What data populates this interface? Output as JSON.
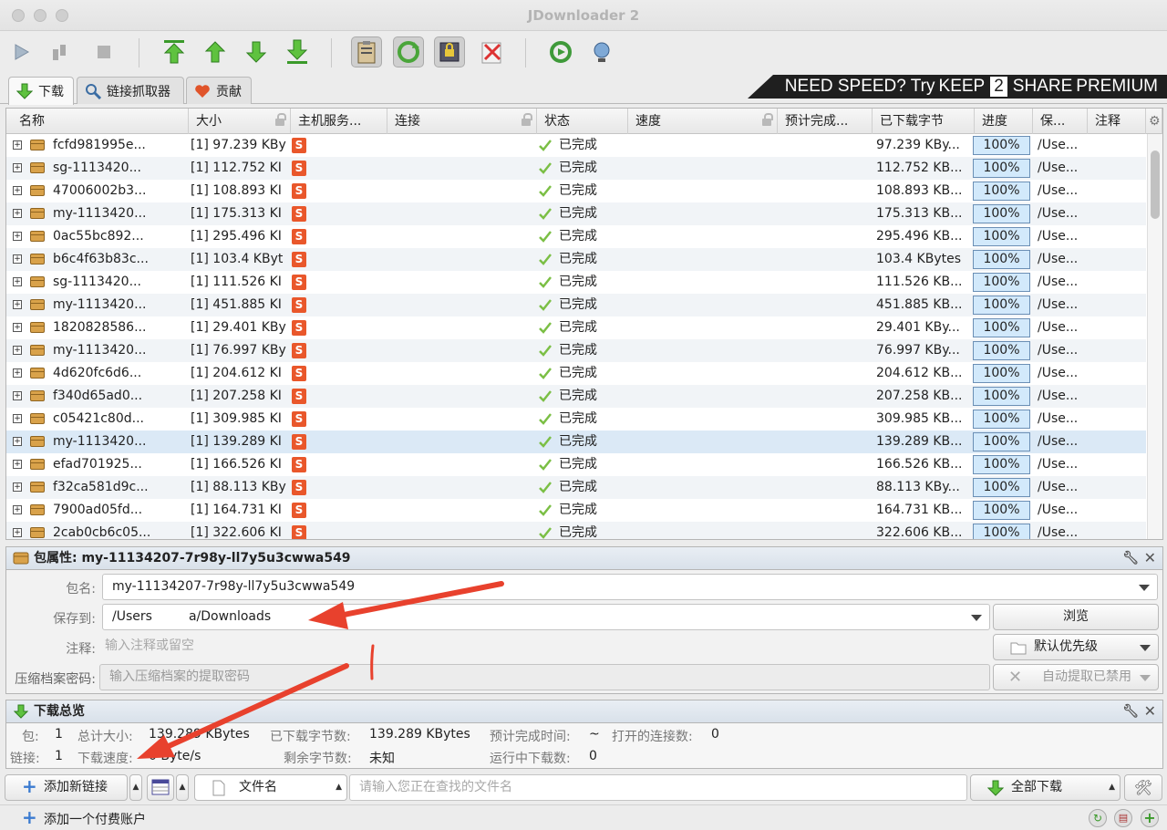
{
  "window": {
    "title": "JDownloader 2"
  },
  "toolbar": {
    "buttons": [
      "play-icon",
      "pause-icon",
      "stop-icon",
      "move-top-icon",
      "move-up-icon",
      "move-down-icon",
      "move-bottom-icon",
      "clipboard-observer-icon",
      "auto-reconnect-icon",
      "premium-lock-icon",
      "silent-mode-icon",
      "update-icon",
      "reconnect-icon"
    ]
  },
  "tabs": [
    {
      "label": "下载",
      "icon": "download-arrow-icon",
      "active": true
    },
    {
      "label": "链接抓取器",
      "icon": "linkgrabber-icon",
      "active": false
    },
    {
      "label": "贡献",
      "icon": "heart-icon",
      "active": false
    }
  ],
  "banner": {
    "text1": "NEED SPEED? Try ",
    "text2": "KEEP",
    "num": "2",
    "text3": "SHARE",
    "text4": " PREMIUM"
  },
  "table": {
    "headers": {
      "name": "名称",
      "size": "大小",
      "host": "主机服务...",
      "connection": "连接",
      "status": "状态",
      "speed": "速度",
      "eta": "预计完成...",
      "downloaded": "已下载字节",
      "progress": "进度",
      "save": "保...",
      "comment": "注释"
    },
    "rows": [
      {
        "name": "fcfd981995e...",
        "size": "[1]  97.239 KBy",
        "status": "已完成",
        "downloaded": "97.239 KBy...",
        "progress": "100%",
        "save": "/Use..."
      },
      {
        "name": "sg-1113420...",
        "size": "[1]  112.752 KI",
        "status": "已完成",
        "downloaded": "112.752 KB...",
        "progress": "100%",
        "save": "/Use..."
      },
      {
        "name": "47006002b3...",
        "size": "[1]  108.893 KI",
        "status": "已完成",
        "downloaded": "108.893 KB...",
        "progress": "100%",
        "save": "/Use..."
      },
      {
        "name": "my-1113420...",
        "size": "[1]  175.313 KI",
        "status": "已完成",
        "downloaded": "175.313 KB...",
        "progress": "100%",
        "save": "/Use..."
      },
      {
        "name": "0ac55bc892...",
        "size": "[1]  295.496 KI",
        "status": "已完成",
        "downloaded": "295.496 KB...",
        "progress": "100%",
        "save": "/Use..."
      },
      {
        "name": "b6c4f63b83c...",
        "size": "[1]  103.4 KByt",
        "status": "已完成",
        "downloaded": "103.4 KBytes",
        "progress": "100%",
        "save": "/Use..."
      },
      {
        "name": "sg-1113420...",
        "size": "[1]  111.526 KI",
        "status": "已完成",
        "downloaded": "111.526 KB...",
        "progress": "100%",
        "save": "/Use..."
      },
      {
        "name": "my-1113420...",
        "size": "[1]  451.885 KI",
        "status": "已完成",
        "downloaded": "451.885 KB...",
        "progress": "100%",
        "save": "/Use..."
      },
      {
        "name": "1820828586...",
        "size": "[1]  29.401 KBy",
        "status": "已完成",
        "downloaded": "29.401 KBy...",
        "progress": "100%",
        "save": "/Use..."
      },
      {
        "name": "my-1113420...",
        "size": "[1]  76.997 KBy",
        "status": "已完成",
        "downloaded": "76.997 KBy...",
        "progress": "100%",
        "save": "/Use..."
      },
      {
        "name": "4d620fc6d6...",
        "size": "[1]  204.612 KI",
        "status": "已完成",
        "downloaded": "204.612 KB...",
        "progress": "100%",
        "save": "/Use..."
      },
      {
        "name": "f340d65ad0...",
        "size": "[1]  207.258 KI",
        "status": "已完成",
        "downloaded": "207.258 KB...",
        "progress": "100%",
        "save": "/Use..."
      },
      {
        "name": "c05421c80d...",
        "size": "[1]  309.985 KI",
        "status": "已完成",
        "downloaded": "309.985 KB...",
        "progress": "100%",
        "save": "/Use..."
      },
      {
        "name": "my-1113420...",
        "size": "[1]  139.289 KI",
        "status": "已完成",
        "downloaded": "139.289 KB...",
        "progress": "100%",
        "save": "/Use...",
        "selected": true
      },
      {
        "name": "efad701925...",
        "size": "[1]  166.526 KI",
        "status": "已完成",
        "downloaded": "166.526 KB...",
        "progress": "100%",
        "save": "/Use..."
      },
      {
        "name": "f32ca581d9c...",
        "size": "[1]  88.113 KBy",
        "status": "已完成",
        "downloaded": "88.113 KBy...",
        "progress": "100%",
        "save": "/Use..."
      },
      {
        "name": "7900ad05fd...",
        "size": "[1]  164.731 KI",
        "status": "已完成",
        "downloaded": "164.731 KB...",
        "progress": "100%",
        "save": "/Use..."
      },
      {
        "name": "2cab0cb6c05...",
        "size": "[1]  322.606 KI",
        "status": "已完成",
        "downloaded": "322.606 KB...",
        "progress": "100%",
        "save": "/Use..."
      }
    ]
  },
  "package_props": {
    "header": "包属性: my-11134207-7r98y-ll7y5u3cwwa549",
    "name_label": "包名:",
    "name_value": "my-11134207-7r98y-ll7y5u3cwwa549",
    "save_label": "保存到:",
    "save_value": "/Users         a/Downloads",
    "browse": "浏览",
    "comment_label": "注释:",
    "comment_placeholder": "输入注释或留空",
    "priority": "默认优先级",
    "password_label": "压缩档案密码:",
    "password_placeholder": "输入压缩档案的提取密码",
    "auto_extract": "自动提取已禁用"
  },
  "overview": {
    "header": "下载总览",
    "packages_label": "包:",
    "packages_value": "1",
    "total_size_label": "总计大小:",
    "total_size_value": "139.289 KBytes",
    "downloaded_label": "已下载字节数:",
    "downloaded_value": "139.289 KBytes",
    "eta_label": "预计完成时间:",
    "eta_value": "~",
    "open_conn_label": "打开的连接数:",
    "open_conn_value": "0",
    "links_label": "链接:",
    "links_value": "1",
    "speed_label": "下载速度:",
    "speed_value": "0 Byte/s",
    "remaining_label": "剩余字节数:",
    "remaining_value": "未知",
    "running_label": "运行中下载数:",
    "running_value": "0"
  },
  "bottom": {
    "add_links": "添加新链接",
    "search_scope": "文件名",
    "search_placeholder": "请输入您正在查找的文件名",
    "download_all": "全部下载"
  },
  "statusbar": {
    "add_account": "添加一个付费账户"
  },
  "colors": {
    "arrow": "#e8412d",
    "selection": "#dbe9f6",
    "progress_fill": "#d2e9fb"
  }
}
